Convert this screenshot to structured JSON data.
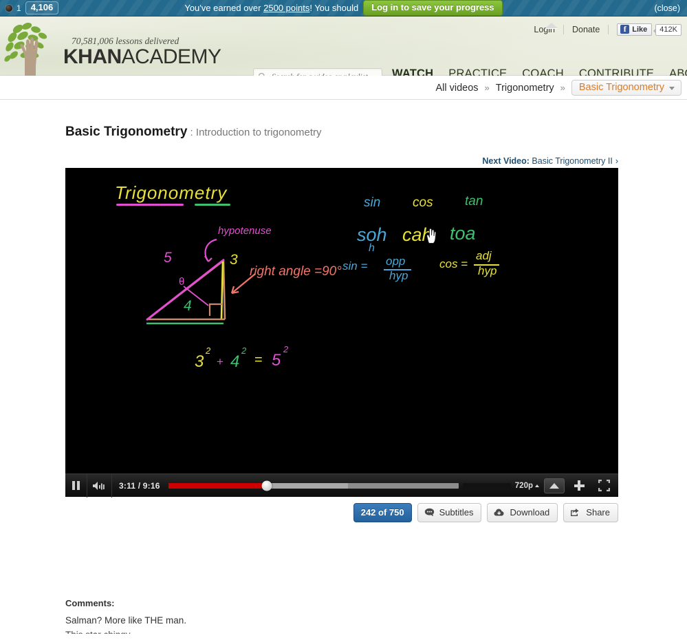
{
  "notification_bar": {
    "streak_count": "1",
    "points": "4,106",
    "message_before": "You've earned over ",
    "message_link": "2500 points",
    "message_after": "! You should",
    "login_button": "Log in to save your progress",
    "close": "(close)",
    "accent_color": "#8cc63e",
    "bar_color": "#246a8e"
  },
  "header": {
    "tagline": "70,581,006 lessons delivered",
    "logo_bold": "KHAN",
    "logo_light": "ACADEMY",
    "login": "Login",
    "donate": "Donate",
    "facebook_like": "Like",
    "facebook_count": "412K"
  },
  "search": {
    "placeholder": "Search for a video or playlist",
    "value": "",
    "icon": "search-icon"
  },
  "nav": {
    "items": [
      {
        "label": "WATCH",
        "active": true
      },
      {
        "label": "PRACTICE",
        "active": false
      },
      {
        "label": "COACH",
        "active": false
      },
      {
        "label": "CONTRIBUTE",
        "active": false
      },
      {
        "label": "ABOUT",
        "active": false
      }
    ]
  },
  "breadcrumb": {
    "root": "All videos",
    "sep1": "»",
    "level2": "Trigonometry",
    "sep2": "»",
    "current": "Basic Trigonometry",
    "current_color": "#e07b20"
  },
  "video": {
    "title": "Basic Trigonometry",
    "title_separator": " : ",
    "subtitle": "Introduction to trigonometry",
    "next_label": "Next Video:",
    "next_title": "Basic Trigonometry II",
    "next_arrow": "›"
  },
  "player": {
    "play_state": "pause-icon",
    "volume_icon": "volume-icon",
    "current_time": "3:11",
    "time_separator": " / ",
    "duration": "9:16",
    "progress_percent": 34,
    "quality": "720p",
    "quality_caret": "caret-up-icon",
    "popout_icon": "popout-icon",
    "plus_icon": "plus-icon",
    "fullscreen_icon": "fullscreen-icon"
  },
  "canvas": {
    "title": "Trigonometry",
    "labels": {
      "hypotenuse": "hypotenuse",
      "five": "5",
      "three": "3",
      "four": "4",
      "theta": "θ",
      "right_angle": "right angle  =90°",
      "sin": "sin",
      "cos": "cos",
      "tan": "tan",
      "soh": "soh",
      "cah": "cah",
      "toa": "toa",
      "soh_sub": "h",
      "sin_formula_left": "sin  =",
      "sin_num": "opp",
      "sin_den": "hyp",
      "cos_formula_left": "cos =",
      "cos_num": "adj",
      "cos_den": "hyp",
      "pyth_a": "3",
      "pyth_a_exp": "2",
      "pyth_plus": "+",
      "pyth_b": "4",
      "pyth_b_exp": "2",
      "pyth_eq": "=",
      "pyth_c": "5",
      "pyth_c_exp": "2"
    },
    "colors": {
      "yellow": "#e8e03a",
      "magenta": "#e24fd0",
      "green": "#3fbf6f",
      "blue": "#4aa7d8",
      "salmon": "#f0756a",
      "tan": "#c88a6a",
      "background": "#000000"
    }
  },
  "actions": {
    "subtitle_count": "242 of 750",
    "subtitles": "Subtitles",
    "download": "Download",
    "share": "Share",
    "badge_color": "#24619c"
  },
  "comments": {
    "heading": "Comments:",
    "first": "Salman? More like THE man.",
    "second": "This star chingy..."
  }
}
